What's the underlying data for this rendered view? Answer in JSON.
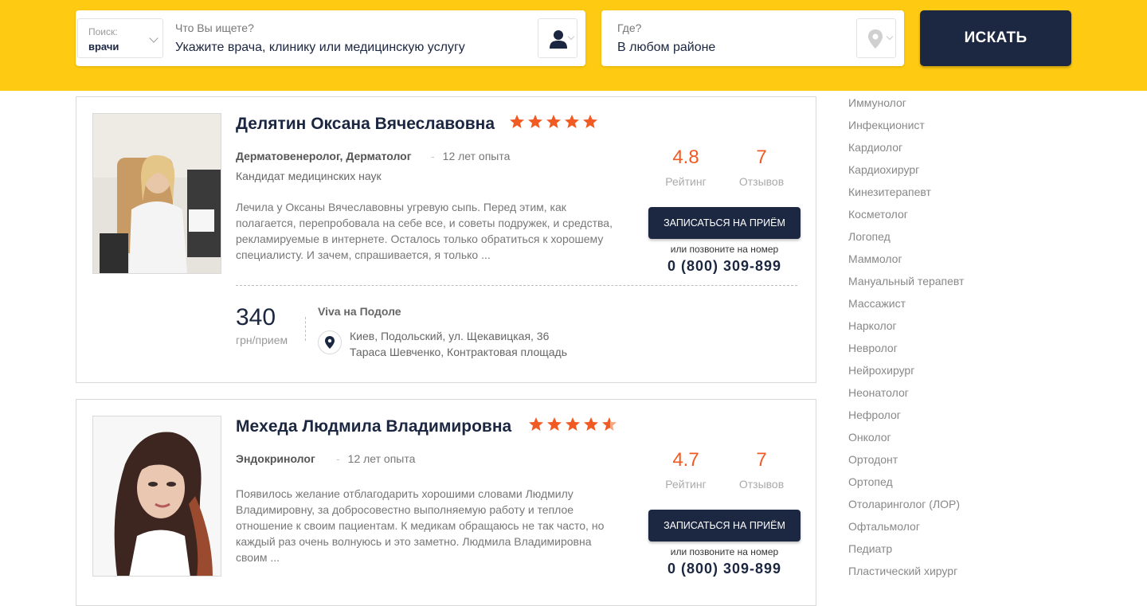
{
  "search": {
    "type_caption": "Поиск:",
    "type_value": "врачи",
    "what_caption": "Что Вы ищете?",
    "what_value": "Укажите врача, клинику или медицинскую услугу",
    "where_caption": "Где?",
    "where_value": "В любом районе",
    "button_label": "ИСКАТЬ"
  },
  "doctors": [
    {
      "name": "Делятин Оксана Вячеславовна",
      "stars": 5,
      "specialty": "Дерматовенеролог, Дерматолог",
      "experience": "12 лет опыта",
      "degree": "Кандидат медицинских наук",
      "review": "Лечила у Оксаны Вячеславовны угревую сыпь. Перед этим, как полагается, перепробовала на себе все, и советы подружек, и средства, рекламируемые в интернете. Осталось только обратиться к хорошему специалисту. И зачем, спрашивается, я только ...",
      "rating": "4.8",
      "rating_label": "Рейтинг",
      "reviews_count": "7",
      "reviews_label": "Отзывов",
      "book_label": "ЗАПИСАТЬСЯ НА ПРИЁМ",
      "call_text": "или позвоните на номер",
      "phone": "0 (800) 309-899",
      "price": "340",
      "price_unit": "грн/прием",
      "clinic": "Viva на Подоле",
      "address_line1": "Киев, Подольский, ул. Щекавицкая, 36",
      "address_line2": "Тараса Шевченко, Контрактовая площадь"
    },
    {
      "name": "Меxеда Людмила Владимировна",
      "stars": 4.5,
      "specialty": "Эндокринолог",
      "experience": "12 лет опыта",
      "review": "Появилось желание отблагодарить хорошими словами Людмилу Владимировну, за добросовестно выполняемую работу и теплое отношение к своим пациентам. К медикам обращаюсь не так часто, но каждый раз очень волнуюсь и это заметно. Людмила Владимировна своим ...",
      "rating": "4.7",
      "rating_label": "Рейтинг",
      "reviews_count": "7",
      "reviews_label": "Отзывов",
      "book_label": "ЗАПИСАТЬСЯ НА ПРИЁМ",
      "call_text": "или позвоните на номер",
      "phone": "0 (800) 309-899"
    }
  ],
  "sidebar": {
    "items": [
      "Иммунолог",
      "Инфекционист",
      "Кардиолог",
      "Кардиохирург",
      "Кинезитерапевт",
      "Косметолог",
      "Логопед",
      "Маммолог",
      "Мануальный терапевт",
      "Массажист",
      "Нарколог",
      "Невролог",
      "Нейрохирург",
      "Неонатолог",
      "Нефролог",
      "Онколог",
      "Ортодонт",
      "Ортопед",
      "Отоларинголог (ЛОР)",
      "Офтальмолог",
      "Педиатр",
      "Пластический хирург"
    ]
  },
  "colors": {
    "header_bg": "#ffcb12",
    "accent": "#f15a22",
    "dark_button": "#1c2741"
  }
}
